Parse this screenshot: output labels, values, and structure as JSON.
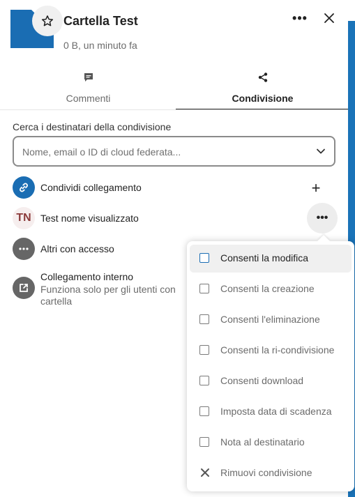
{
  "header": {
    "title": "Cartella Test",
    "subtitle": "0 B, un minuto fa",
    "more_label": "•••"
  },
  "tabs": [
    {
      "label": "Commenti",
      "icon": "comment-icon",
      "active": false
    },
    {
      "label": "Condivisione",
      "icon": "share-icon",
      "active": true
    }
  ],
  "search": {
    "label": "Cerca i destinatari della condivisione",
    "placeholder": "Nome, email o ID di cloud federata..."
  },
  "shares": {
    "link": {
      "label": "Condividi collegamento",
      "add_label": "+"
    },
    "user": {
      "initials": "TN",
      "label": "Test nome visualizzato",
      "more_label": "•••"
    },
    "others": {
      "label": "Altri con accesso"
    },
    "internal": {
      "title": "Collegamento interno",
      "description": "Funziona solo per gli utenti con cartella"
    }
  },
  "menu": {
    "items": [
      {
        "label": "Consenti la modifica",
        "type": "checkbox",
        "checked": false,
        "active": true
      },
      {
        "label": "Consenti la creazione",
        "type": "checkbox",
        "checked": false
      },
      {
        "label": "Consenti l'eliminazione",
        "type": "checkbox",
        "checked": false
      },
      {
        "label": "Consenti la ri-condivisione",
        "type": "checkbox",
        "checked": false
      },
      {
        "label": "Consenti download",
        "type": "checkbox",
        "checked": false
      },
      {
        "label": "Imposta data di scadenza",
        "type": "checkbox",
        "checked": false
      },
      {
        "label": "Nota al destinatario",
        "type": "checkbox",
        "checked": false
      },
      {
        "label": "Rimuovi condivisione",
        "type": "action"
      }
    ]
  },
  "colors": {
    "accent": "#1a6db3",
    "folder": "#1a6db3",
    "avatar_gray": "#666666",
    "text_muted": "#6b6b6b"
  }
}
